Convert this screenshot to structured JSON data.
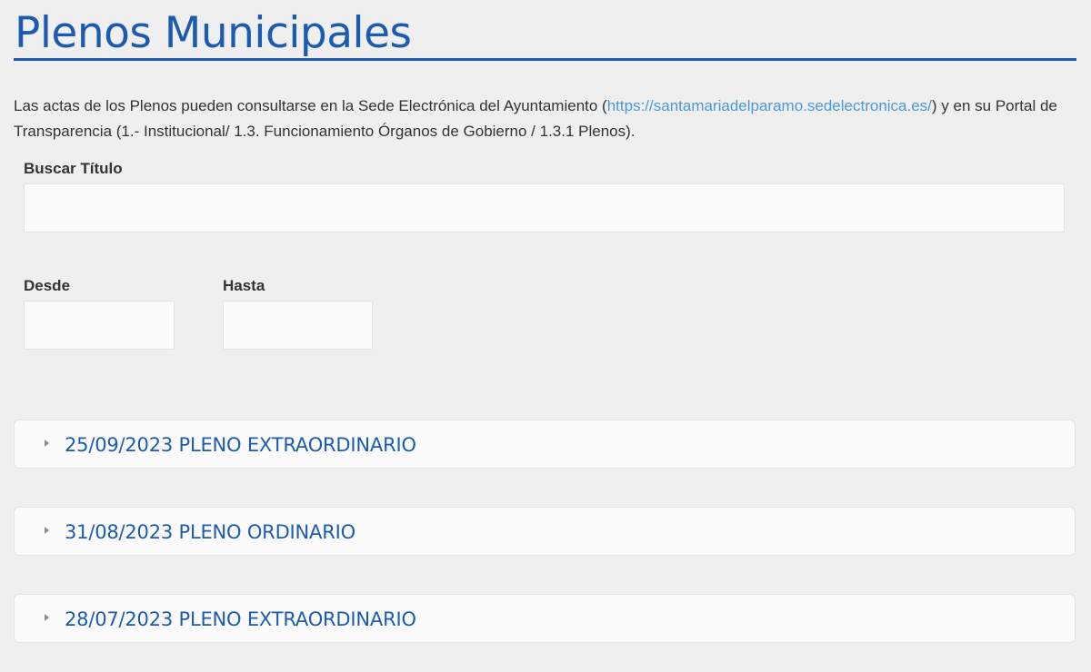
{
  "page": {
    "title": "Plenos Municipales"
  },
  "intro": {
    "text_before": "Las actas de los Plenos pueden consultarse en la Sede Electrónica del Ayuntamiento (",
    "link_text": "https://santamariadelparamo.sedelectronica.es/",
    "text_after": ") y en su Portal de Transparencia (1.- Institucional/ 1.3. Funcionamiento Órganos de Gobierno / 1.3.1 Plenos)."
  },
  "filters": {
    "search_label": "Buscar Título",
    "search_value": "",
    "from_label": "Desde",
    "from_value": "",
    "to_label": "Hasta",
    "to_value": ""
  },
  "accordion": {
    "items": [
      {
        "label": "25/09/2023 PLENO EXTRAORDINARIO"
      },
      {
        "label": "31/08/2023 PLENO ORDINARIO"
      },
      {
        "label": "28/07/2023 PLENO EXTRAORDINARIO"
      }
    ]
  },
  "colors": {
    "accent": "#1c5bb0",
    "link": "#4a9ad6",
    "background": "#efefef"
  },
  "icons": {
    "accordion_toggle": "caret-right-icon"
  }
}
